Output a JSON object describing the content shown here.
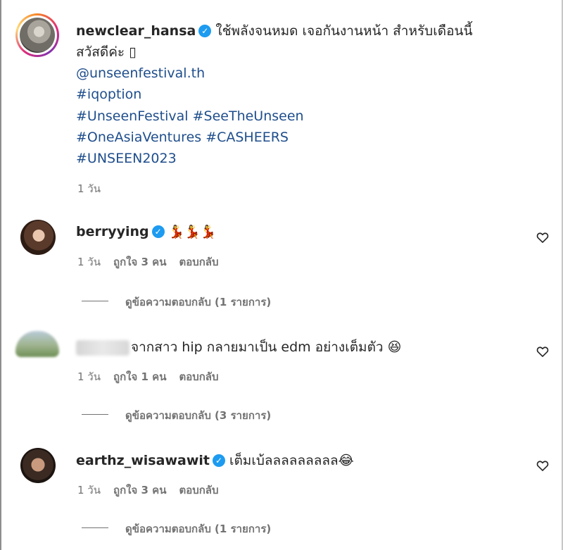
{
  "caption": {
    "username": "newclear_hansa",
    "text_line1": "ใช้พลังจนหมด เจอกันงานหน้า สำหรับเดือนนี้",
    "text_line2": "สวัสดีค่ะ ",
    "placeholder_glyph": "▯",
    "mention": "@unseenfestival.th",
    "hashtags_1": "#iqoption",
    "hashtags_2": "#UnseenFestival #SeeTheUnseen",
    "hashtags_3": "#OneAsiaVentures #CASHEERS",
    "hashtags_4": "#UNSEEN2023",
    "time": "1 วัน"
  },
  "comments": [
    {
      "username": "berryying",
      "text": "💃💃💃",
      "time": "1 วัน",
      "likes": "ถูกใจ 3 คน",
      "reply_label": "ตอบกลับ",
      "view_replies": "ดูข้อความตอบกลับ (1 รายการ)"
    },
    {
      "username": "",
      "text": "จากสาว hip กลายมาเป็น edm อย่างเต็มตัว 😆",
      "time": "1 วัน",
      "likes": "ถูกใจ 1 คน",
      "reply_label": "ตอบกลับ",
      "view_replies": "ดูข้อความตอบกลับ (3 รายการ)"
    },
    {
      "username": "earthz_wisawawit",
      "text": "เต็มเบ้ลลลลลลลลล😂",
      "time": "1 วัน",
      "likes": "ถูกใจ 3 คน",
      "reply_label": "ตอบกลับ",
      "view_replies": "ดูข้อความตอบกลับ (1 รายการ)"
    }
  ],
  "colors": {
    "link": "#1f4e8c",
    "meta": "#737373",
    "verified": "#1d9bf0"
  },
  "icons": {
    "verified": "verified-badge-icon",
    "like": "heart-icon"
  }
}
